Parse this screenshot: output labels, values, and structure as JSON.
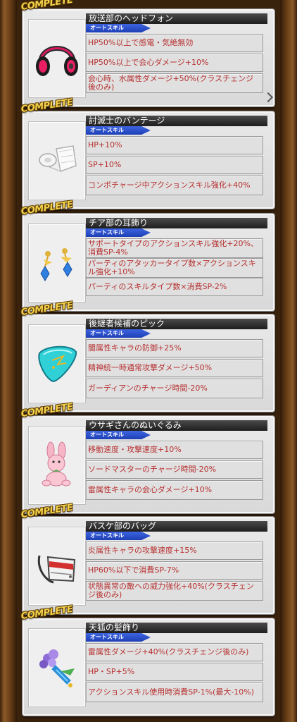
{
  "badge_text": "COMPLETE",
  "colors": {
    "title_bg": "#1e1e1e",
    "tag_bg": "#2a4fd0",
    "skill_text": "#b73131",
    "badge_gold": "#f3d24a",
    "frame_wood": "#6b4018"
  },
  "items": [
    {
      "name": "放送部のヘッドフォン",
      "tag": "オートスキル",
      "icon": "headphones-icon",
      "skills": [
        "HP50%以上で感電・気絶無効",
        "HP50%以上で会心ダメージ+10%",
        "会心時、水属性ダメージ+50%(クラスチェンジ後のみ)"
      ]
    },
    {
      "name": "討滅士のバンテージ",
      "tag": "オートスキル",
      "icon": "bandage-icon",
      "skills": [
        "HP+10%",
        "SP+10%",
        "コンボチャージ中アクションスキル強化+40%"
      ]
    },
    {
      "name": "チア部の耳飾り",
      "tag": "オートスキル",
      "icon": "earrings-icon",
      "skills": [
        "サポートタイプのアクションスキル強化+20%、消費SP-4%",
        "パーティのアタッカータイプ数×アクションスキル強化+10%",
        "パーティのスキルタイプ数×消費SP-2%"
      ]
    },
    {
      "name": "後継者候補のピック",
      "tag": "オートスキル",
      "icon": "guitar-pick-icon",
      "skills": [
        "闇属性キャラの防御+25%",
        "精神統一時通常攻撃ダメージ+50%",
        "ガーディアンのチャージ時間-20%"
      ]
    },
    {
      "name": "ウサギさんのぬいぐるみ",
      "tag": "オートスキル",
      "icon": "bunny-plush-icon",
      "skills": [
        "移動速度・攻撃速度+10%",
        "ソードマスターのチャージ時間-20%",
        "雷属性キャラの会心ダメージ+10%"
      ]
    },
    {
      "name": "バスケ部のバッグ",
      "tag": "オートスキル",
      "icon": "bag-icon",
      "skills": [
        "炎属性キャラの攻撃速度+15%",
        "HP60%以下で消費SP-7%",
        "状態異常の敵への威力強化+40%(クラスチェンジ後のみ)"
      ]
    },
    {
      "name": "天狐の髪飾り",
      "tag": "オートスキル",
      "icon": "hair-ornament-icon",
      "skills": [
        "雷属性ダメージ+40%(クラスチェンジ後のみ)",
        "HP・SP+5%",
        "アクションスキル使用時消費SP-1%(最大-10%)"
      ]
    }
  ]
}
